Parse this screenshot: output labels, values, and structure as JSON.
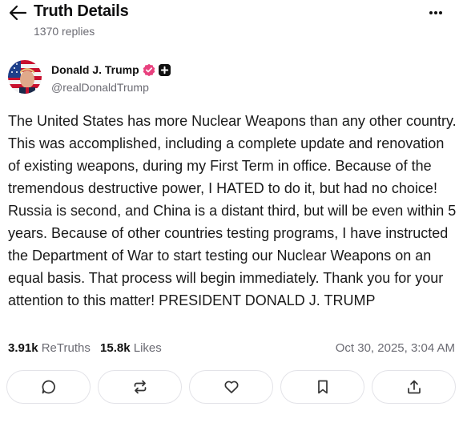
{
  "header": {
    "title": "Truth Details",
    "replies": "1370 replies",
    "back_icon": "arrow-left-icon",
    "more_icon": "more-horizontal-icon"
  },
  "post": {
    "author_name": "Donald J. Trump",
    "handle": "@realDonaldTrump",
    "verified_icon": "verified-badge-icon",
    "plus_icon": "plus-badge-icon",
    "body": "The United States has more Nuclear Weapons than any other country. This was accomplished, including a complete update and renovation of existing weapons, during my First Term in office. Because of the tremendous destructive power, I HATED to do it, but had no choice! Russia is second, and China is a distant third, but will be even within 5 years. Because of other countries testing programs, I have instructed the Department of War to start testing our Nuclear Weapons on an equal basis. That process will begin immediately. Thank you for your attention to this matter! PRESIDENT DONALD J. TRUMP",
    "retruths_count": "3.91k",
    "retruths_label": "ReTruths",
    "likes_count": "15.8k",
    "likes_label": "Likes",
    "timestamp": "Oct 30, 2025, 3:04 AM"
  },
  "actions": [
    "reply-icon",
    "retruth-icon",
    "like-heart-icon",
    "bookmark-icon",
    "share-upload-icon"
  ],
  "colors": {
    "text_primary": "#111111",
    "text_secondary": "#6b6b73",
    "border": "#e3e3e8",
    "verified_pink": "#e8417e"
  }
}
